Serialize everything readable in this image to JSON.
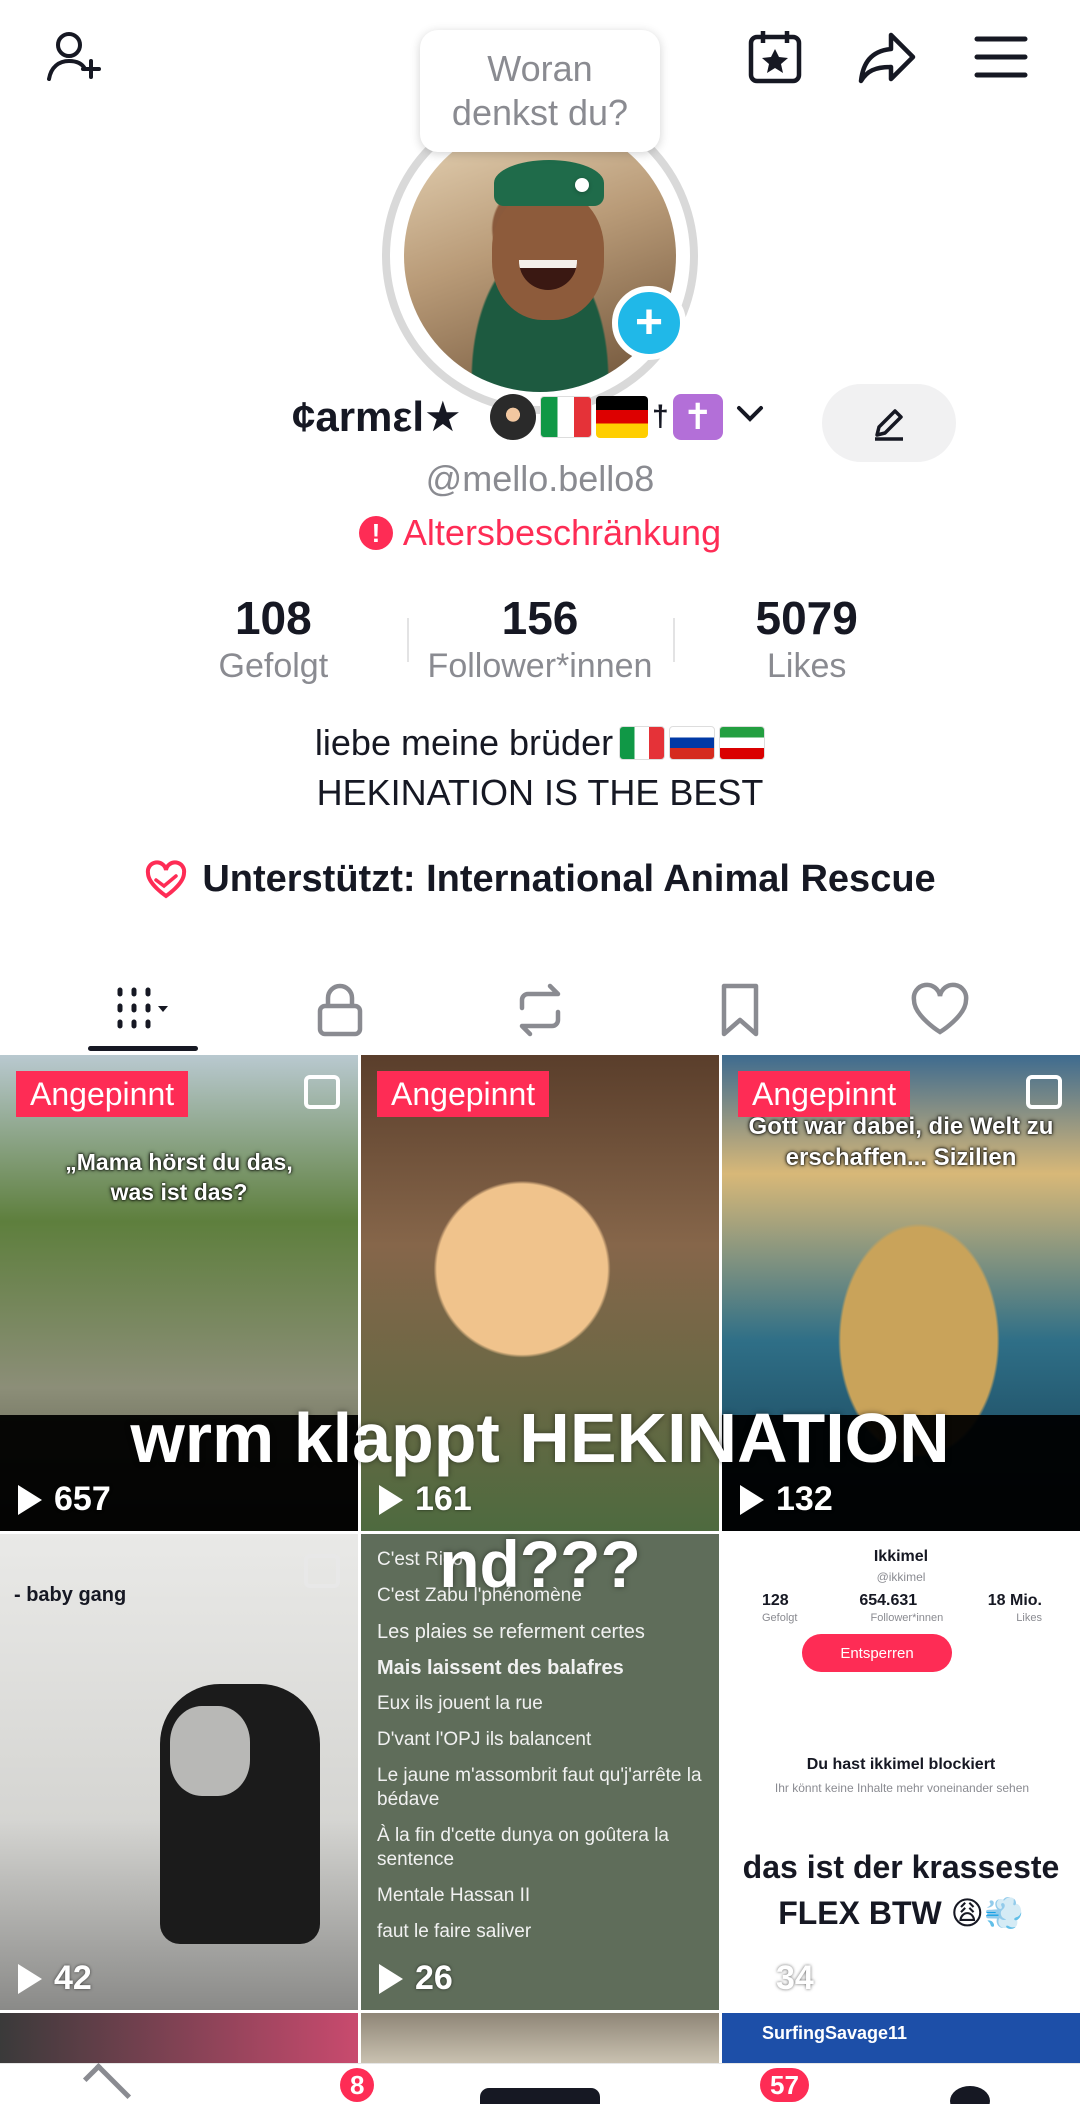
{
  "profile": {
    "bubble_text": "Woran denkst du?",
    "display_name": "¢armεl★",
    "cross_symbol": "✝",
    "username": "@mello.bello8",
    "age_restriction": "Altersbeschränkung",
    "stats": [
      {
        "value": "108",
        "label": "Gefolgt"
      },
      {
        "value": "156",
        "label": "Follower*innen"
      },
      {
        "value": "5079",
        "label": "Likes"
      }
    ],
    "bio_line1": "liebe meine brüder",
    "bio_line2": "HEKINATION IS THE BEST",
    "supports": "Unterstützt: International Animal Rescue"
  },
  "icons": {
    "add_friend": "add-user-icon",
    "calendar": "calendar-star-icon",
    "share": "share-icon",
    "menu": "menu-icon",
    "edit": "pencil-icon"
  },
  "colors": {
    "accent": "#fe2c55",
    "plus_badge": "#20b8e8"
  },
  "tiles": [
    {
      "pinned": "Angepinnt",
      "text": "„Mama hörst du das, was ist das?",
      "views": "657"
    },
    {
      "pinned": "Angepinnt",
      "text": "",
      "views": "161"
    },
    {
      "pinned": "Angepinnt",
      "text": "Gott war dabei, die Welt zu erschaffen... Sizilien",
      "views": "132"
    },
    {
      "pinned": "",
      "text": "- baby gang",
      "views": "42"
    },
    {
      "pinned": "",
      "text": "",
      "views": "26"
    },
    {
      "pinned": "",
      "text": "das ist der krasseste FLEX BTW 😩💨",
      "views": "34"
    }
  ],
  "tile5_lyrics": [
    "C'est Rico",
    "C'est Zabu l'phénomène",
    "Les plaies se referment certes",
    "Mais laissent des balafres",
    "Eux ils jouent la rue",
    "D'vant l'OPJ ils balancent",
    "Le jaune m'assombrit faut qu'j'arrête la bédave",
    "À la fin d'cette dunya on goûtera la sentence",
    "Mentale Hassan II",
    "faut le faire saliver"
  ],
  "tile6_profile": {
    "name": "Ikkimel",
    "handle": "@ikkimel",
    "stats": [
      "128",
      "654.631",
      "18 Mio."
    ],
    "labels": [
      "Gefolgt",
      "Follower*innen",
      "Likes"
    ],
    "button": "Entsperren",
    "blocked": "Du hast ikkimel blockiert",
    "blocked_sub": "Ihr könnt keine Inhalte mehr voneinander sehen"
  },
  "overlay_caption": {
    "line1": "wrm klappt HEKINATION",
    "line2": "nd???"
  },
  "row3_label": "SurfingSavage11",
  "bottom_nav": {
    "inbox_badge": "8",
    "messages_badge": "57"
  }
}
